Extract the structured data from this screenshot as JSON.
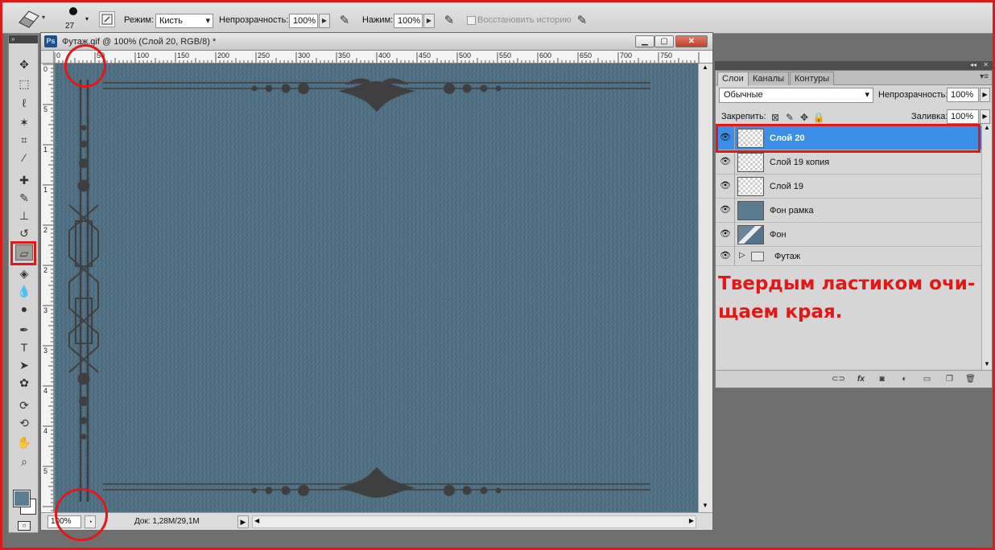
{
  "options_bar": {
    "brush_size": "27",
    "mode_label": "Режим:",
    "mode_value": "Кисть",
    "opacity_label": "Непрозрачность:",
    "opacity_value": "100%",
    "flow_label": "Нажим:",
    "flow_value": "100%",
    "erase_history_label": "Восстановить историю"
  },
  "document": {
    "title": "Футаж.gif @ 100% (Слой 20, RGB/8) *",
    "ruler_h": [
      "0",
      "50",
      "100",
      "150",
      "200",
      "250",
      "300",
      "350",
      "400",
      "450",
      "500",
      "550",
      "600",
      "650",
      "700",
      "750"
    ],
    "ruler_v": [
      "0",
      "5",
      "1",
      "1",
      "2",
      "2",
      "3",
      "3",
      "4",
      "4",
      "5"
    ],
    "zoom": "100%",
    "doc_info": "Док: 1,28M/29,1M",
    "canvas_color": "#4d6f84",
    "ornament_color": "#3f3f3f"
  },
  "layers_panel": {
    "tabs": [
      "Слои",
      "Каналы",
      "Контуры"
    ],
    "blend_mode": "Обычные",
    "opacity_label": "Непрозрачность:",
    "opacity_value": "100%",
    "lock_label": "Закрепить:",
    "fill_label": "Заливка:",
    "fill_value": "100%",
    "layers": [
      {
        "name": "Слой 20",
        "selected": true,
        "thumb": "transparent"
      },
      {
        "name": "Слой 19 копия",
        "selected": false,
        "thumb": "transparent"
      },
      {
        "name": "Слой 19",
        "selected": false,
        "thumb": "transparent"
      },
      {
        "name": "Фон рамка",
        "selected": false,
        "thumb": "fill"
      },
      {
        "name": "Фон",
        "selected": false,
        "thumb": "photo"
      },
      {
        "name": "Футаж",
        "selected": false,
        "thumb": "group"
      }
    ],
    "annotation": "Твердым ластиком очи-щаем края.",
    "selection_color": "#3b8fe8"
  },
  "colors": {
    "highlight": "#e21818",
    "foreground_swatch": "#5a7d91",
    "background_swatch": "#ffffff"
  }
}
